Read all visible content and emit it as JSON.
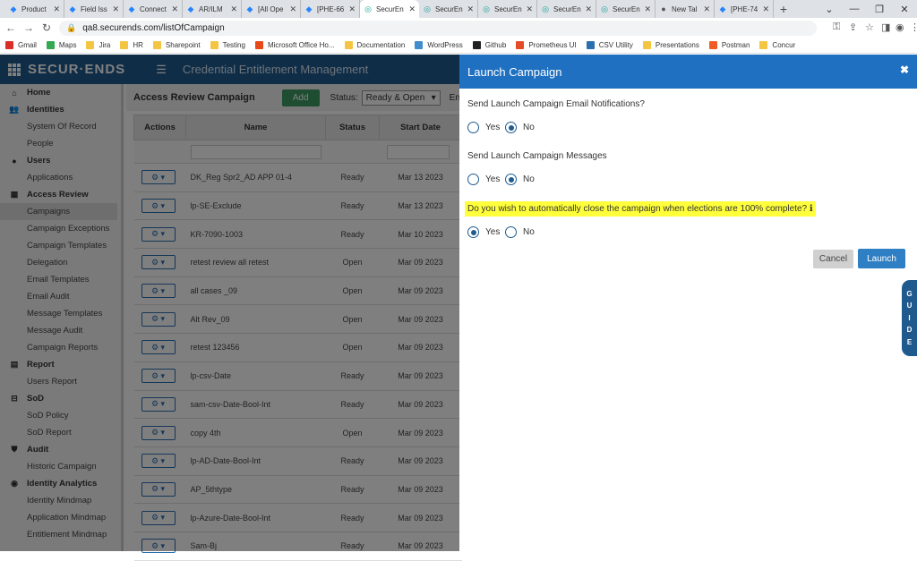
{
  "browser": {
    "tabs": [
      {
        "label": "Product",
        "icon": "jira-icon",
        "active": false
      },
      {
        "label": "Field Iss",
        "icon": "jira-icon",
        "active": false
      },
      {
        "label": "Connect",
        "icon": "jira-icon",
        "active": false
      },
      {
        "label": "AR/ILM",
        "icon": "jira-icon",
        "active": false
      },
      {
        "label": "[All Ope",
        "icon": "jira-icon",
        "active": false
      },
      {
        "label": "[PHE-66",
        "icon": "jira-icon",
        "active": false
      },
      {
        "label": "SecurEn",
        "icon": "securends-icon",
        "active": true
      },
      {
        "label": "SecurEn",
        "icon": "securends-icon",
        "active": false
      },
      {
        "label": "SecurEn",
        "icon": "securends-icon",
        "active": false
      },
      {
        "label": "SecurEn",
        "icon": "securends-icon",
        "active": false
      },
      {
        "label": "SecurEn",
        "icon": "securends-icon",
        "active": false
      },
      {
        "label": "New Tal",
        "icon": "chrome-icon",
        "active": false
      },
      {
        "label": "[PHE-74",
        "icon": "jira-icon",
        "active": false
      }
    ],
    "url": "qa8.securends.com/listOfCampaign",
    "bookmarks": [
      {
        "label": "Gmail",
        "color": "#d93025"
      },
      {
        "label": "Maps",
        "color": "#34a853"
      },
      {
        "label": "Jira",
        "color": "#f4c542"
      },
      {
        "label": "HR",
        "color": "#f4c542"
      },
      {
        "label": "Sharepoint",
        "color": "#f4c542"
      },
      {
        "label": "Testing",
        "color": "#f4c542"
      },
      {
        "label": "Microsoft Office Ho...",
        "color": "#e64a19"
      },
      {
        "label": "Documentation",
        "color": "#f4c542"
      },
      {
        "label": "WordPress",
        "color": "#3f8ccf"
      },
      {
        "label": "Github",
        "color": "#222222"
      },
      {
        "label": "Prometheus UI",
        "color": "#e34c26"
      },
      {
        "label": "CSV Utility",
        "color": "#2a6fb0"
      },
      {
        "label": "Presentations",
        "color": "#f4c542"
      },
      {
        "label": "Postman",
        "color": "#ef5b25"
      },
      {
        "label": "Concur",
        "color": "#f4c542"
      }
    ]
  },
  "app": {
    "logo": "SECUR·ENDS",
    "title": "Credential Entitlement Management"
  },
  "sidebar": [
    {
      "label": "Home",
      "type": "head",
      "icon": "home-icon",
      "glyph": "⌂"
    },
    {
      "label": "Identities",
      "type": "head",
      "icon": "users-icon",
      "glyph": "👥"
    },
    {
      "label": "System Of Record",
      "type": "item"
    },
    {
      "label": "People",
      "type": "item"
    },
    {
      "label": "Users",
      "type": "head",
      "icon": "user-icon",
      "glyph": "●"
    },
    {
      "label": "Applications",
      "type": "item"
    },
    {
      "label": "Access Review",
      "type": "head",
      "icon": "grid-icon",
      "glyph": "▦"
    },
    {
      "label": "Campaigns",
      "type": "item",
      "active": true
    },
    {
      "label": "Campaign Exceptions",
      "type": "item"
    },
    {
      "label": "Campaign Templates",
      "type": "item"
    },
    {
      "label": "Delegation",
      "type": "item"
    },
    {
      "label": "Email Templates",
      "type": "item"
    },
    {
      "label": "Email Audit",
      "type": "item"
    },
    {
      "label": "Message Templates",
      "type": "item"
    },
    {
      "label": "Message Audit",
      "type": "item"
    },
    {
      "label": "Campaign Reports",
      "type": "item"
    },
    {
      "label": "Report",
      "type": "head",
      "icon": "report-icon",
      "glyph": "▤"
    },
    {
      "label": "Users Report",
      "type": "item"
    },
    {
      "label": "SoD",
      "type": "head",
      "icon": "sod-icon",
      "glyph": "⊟"
    },
    {
      "label": "SoD Policy",
      "type": "item"
    },
    {
      "label": "SoD Report",
      "type": "item"
    },
    {
      "label": "Audit",
      "type": "head",
      "icon": "shield-icon",
      "glyph": "⛊"
    },
    {
      "label": "Historic Campaign",
      "type": "item"
    },
    {
      "label": "Identity Analytics",
      "type": "head",
      "icon": "analytics-icon",
      "glyph": "◉"
    },
    {
      "label": "Identity Mindmap",
      "type": "item"
    },
    {
      "label": "Application Mindmap",
      "type": "item"
    },
    {
      "label": "Entitlement Mindmap",
      "type": "item"
    }
  ],
  "toolbar": {
    "title": "Access Review Campaign",
    "add_label": "Add",
    "status_label": "Status:",
    "status_value": "Ready & Open",
    "enabled_label": "Enabled"
  },
  "table": {
    "headers": [
      "Actions",
      "Name",
      "Status",
      "Start Date"
    ],
    "rows": [
      {
        "name": "DK_Reg Spr2_AD APP 01-4",
        "status": "Ready",
        "date": "Mar 13 2023"
      },
      {
        "name": "lp-SE-Exclude",
        "status": "Ready",
        "date": "Mar 13 2023"
      },
      {
        "name": "KR-7090-1003",
        "status": "Ready",
        "date": "Mar 10 2023"
      },
      {
        "name": "retest review all retest",
        "status": "Open",
        "date": "Mar 09 2023"
      },
      {
        "name": "all cases _09",
        "status": "Open",
        "date": "Mar 09 2023"
      },
      {
        "name": "Alt Rev_09",
        "status": "Open",
        "date": "Mar 09 2023"
      },
      {
        "name": "retest 123456",
        "status": "Open",
        "date": "Mar 09 2023"
      },
      {
        "name": "lp-csv-Date",
        "status": "Ready",
        "date": "Mar 09 2023"
      },
      {
        "name": "sam-csv-Date-Bool-Int",
        "status": "Ready",
        "date": "Mar 09 2023"
      },
      {
        "name": "copy 4th",
        "status": "Open",
        "date": "Mar 09 2023"
      },
      {
        "name": "lp-AD-Date-Bool-Int",
        "status": "Ready",
        "date": "Mar 09 2023"
      },
      {
        "name": "AP_5thtype",
        "status": "Ready",
        "date": "Mar 09 2023"
      },
      {
        "name": "lp-Azure-Date-Bool-Int",
        "status": "Ready",
        "date": "Mar 09 2023"
      },
      {
        "name": "Sam-Bj",
        "status": "Ready",
        "date": "Mar 09 2023"
      }
    ]
  },
  "modal": {
    "title": "Launch Campaign",
    "q1": "Send Launch Campaign Email Notifications?",
    "q2": "Send Launch Campaign Messages",
    "q3": "Do you wish to automatically close the campaign when elections are 100% complete?",
    "yes": "Yes",
    "no": "No",
    "q1_selected": "No",
    "q2_selected": "No",
    "q3_selected": "Yes",
    "cancel_label": "Cancel",
    "launch_label": "Launch",
    "guide_letters": [
      "G",
      "U",
      "I",
      "D",
      "E"
    ],
    "highlight_color": "#ffff3c"
  }
}
